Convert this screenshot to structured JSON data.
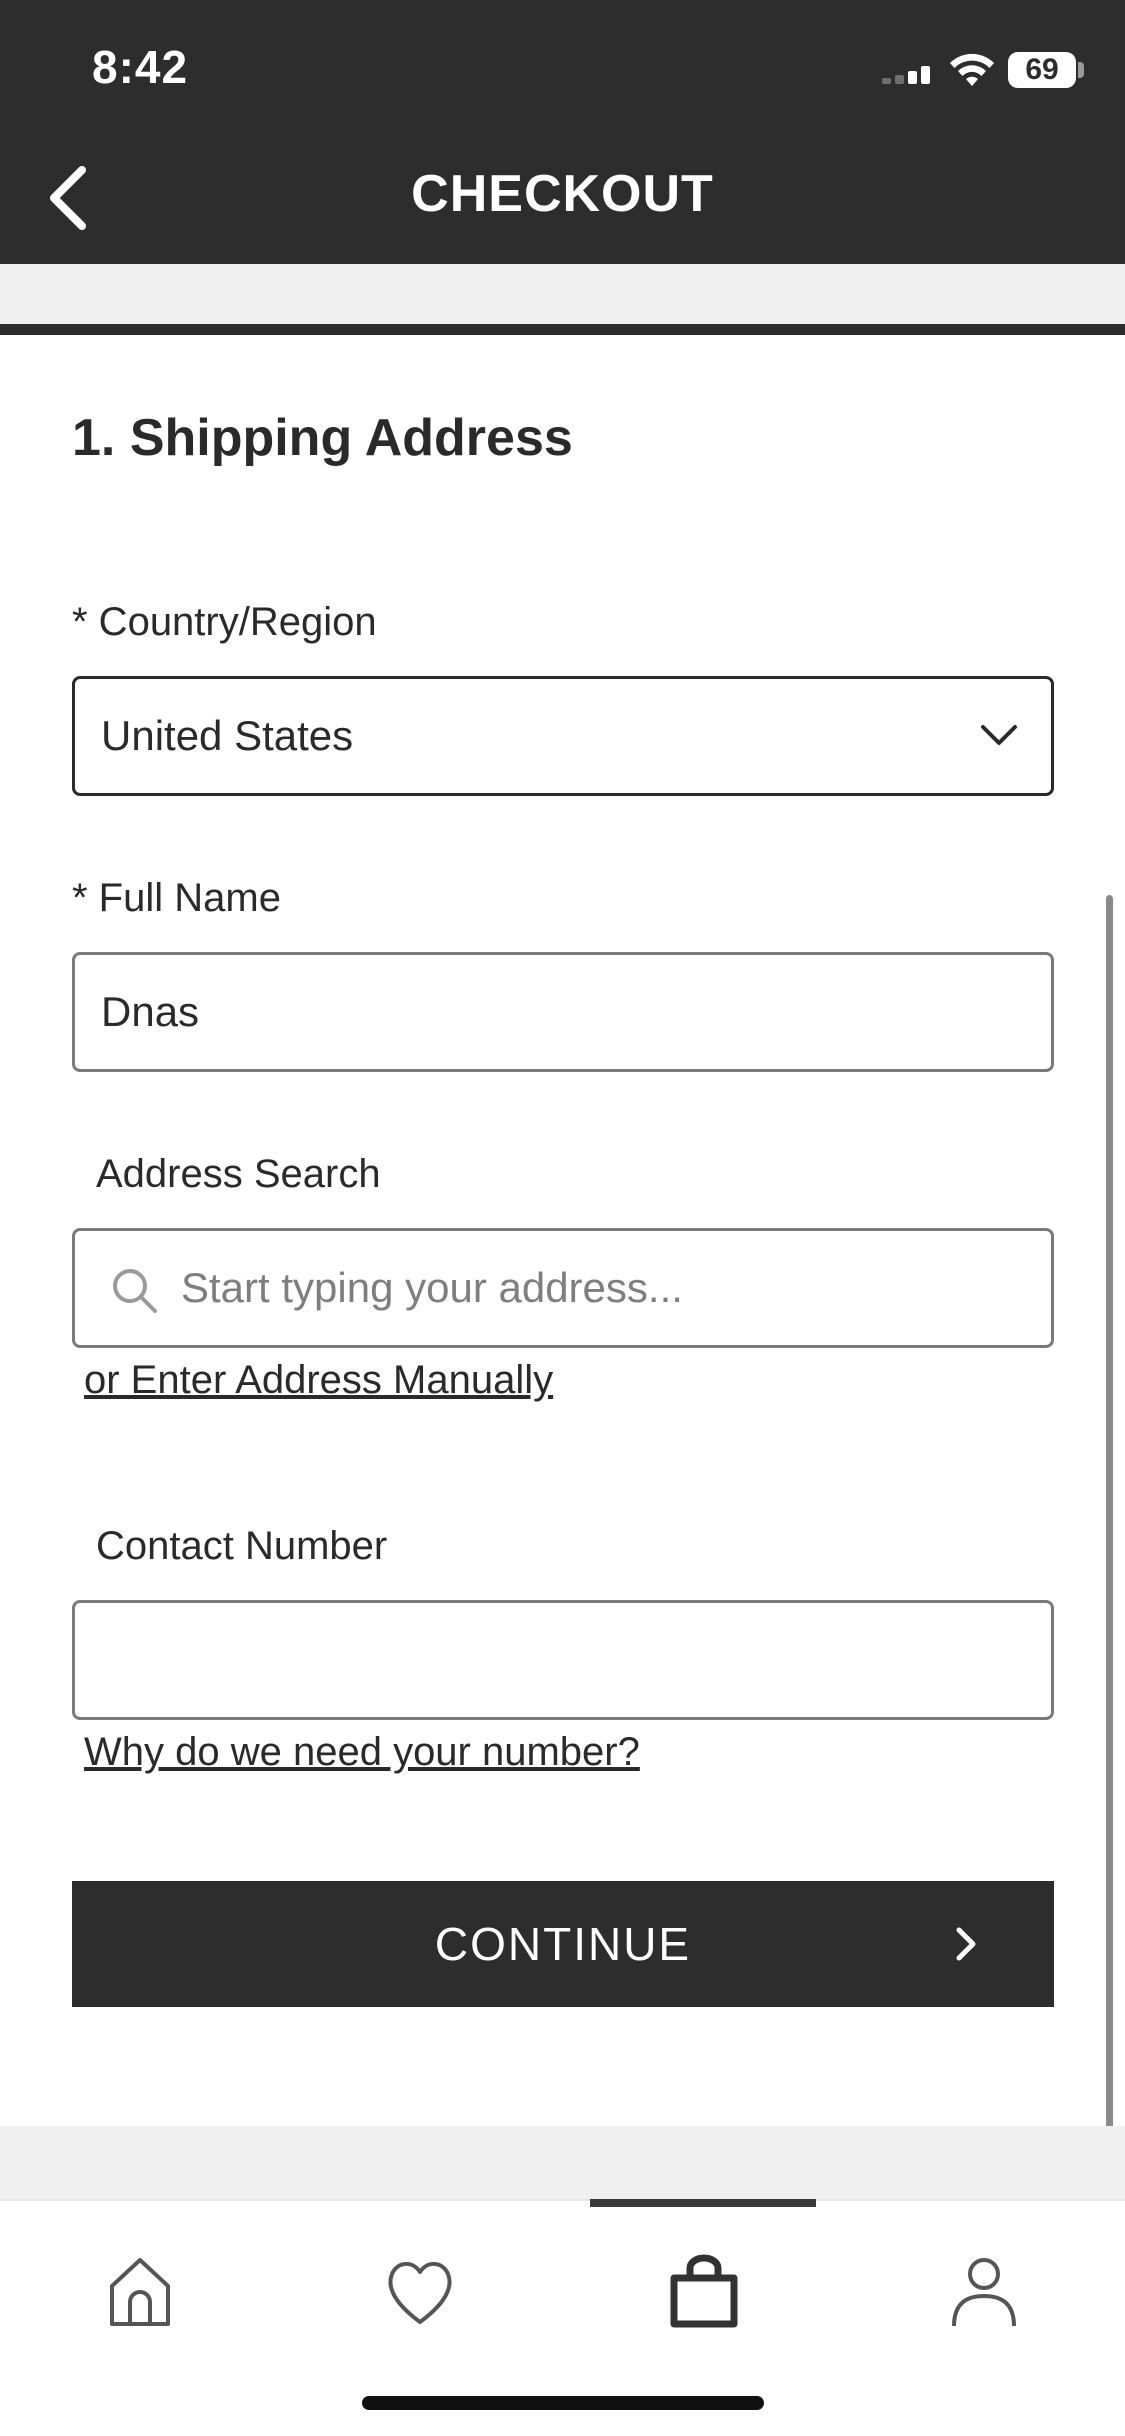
{
  "status_bar": {
    "time": "8:42",
    "battery": "69"
  },
  "header": {
    "title": "CHECKOUT",
    "back_icon": "chevron-left-icon"
  },
  "form": {
    "section_title": "1. Shipping Address",
    "country": {
      "label": "* Country/Region",
      "value": "United States",
      "icon": "chevron-down-icon"
    },
    "full_name": {
      "label": "* Full Name",
      "value": "Dnas"
    },
    "address_search": {
      "label": "Address Search",
      "placeholder": "Start typing your address...",
      "icon": "search-icon"
    },
    "manual_address_link": "or Enter Address Manually",
    "contact_number": {
      "label": "Contact Number",
      "value": ""
    },
    "why_number_link": "Why do we need your number?",
    "continue_label": "CONTINUE"
  },
  "tab_bar": {
    "items": [
      {
        "name": "home",
        "icon": "home-icon"
      },
      {
        "name": "wishlist",
        "icon": "heart-icon"
      },
      {
        "name": "bag",
        "icon": "shopping-bag-icon",
        "active": true
      },
      {
        "name": "account",
        "icon": "user-icon"
      }
    ]
  },
  "colors": {
    "header_bg": "#2d2d2d",
    "button_bg": "#2d2d2d",
    "band_gray": "#f0f0f0",
    "border_gray": "#7a7a7a"
  }
}
